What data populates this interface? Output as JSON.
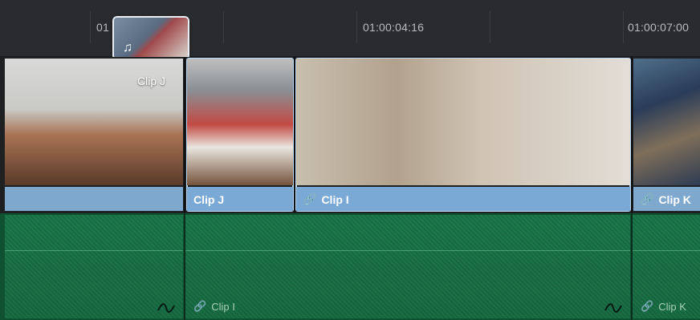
{
  "ruler": {
    "timecodes": [
      {
        "text": "01"
      },
      {
        "text": "01:00:04:16"
      },
      {
        "text": "01:00:07:00"
      }
    ]
  },
  "drag_preview": {
    "icon": "music-note-icon"
  },
  "video_track": {
    "clips": [
      {
        "label": "",
        "overlay_label": "Clip J"
      },
      {
        "label": "Clip J"
      },
      {
        "label": "Clip I",
        "link_icon": "link-icon"
      },
      {
        "label": "Clip K",
        "link_icon": "link-icon"
      }
    ]
  },
  "audio_track": {
    "clips": [
      {
        "label": ""
      },
      {
        "label": "Clip I",
        "link_icon": "link-icon"
      },
      {
        "label": "Clip K",
        "link_icon": "link-icon"
      }
    ]
  },
  "colors": {
    "video_bar": "#7fa8cf",
    "audio_clip": "#1b7a4c",
    "ruler_bg": "#2a2b2e"
  }
}
